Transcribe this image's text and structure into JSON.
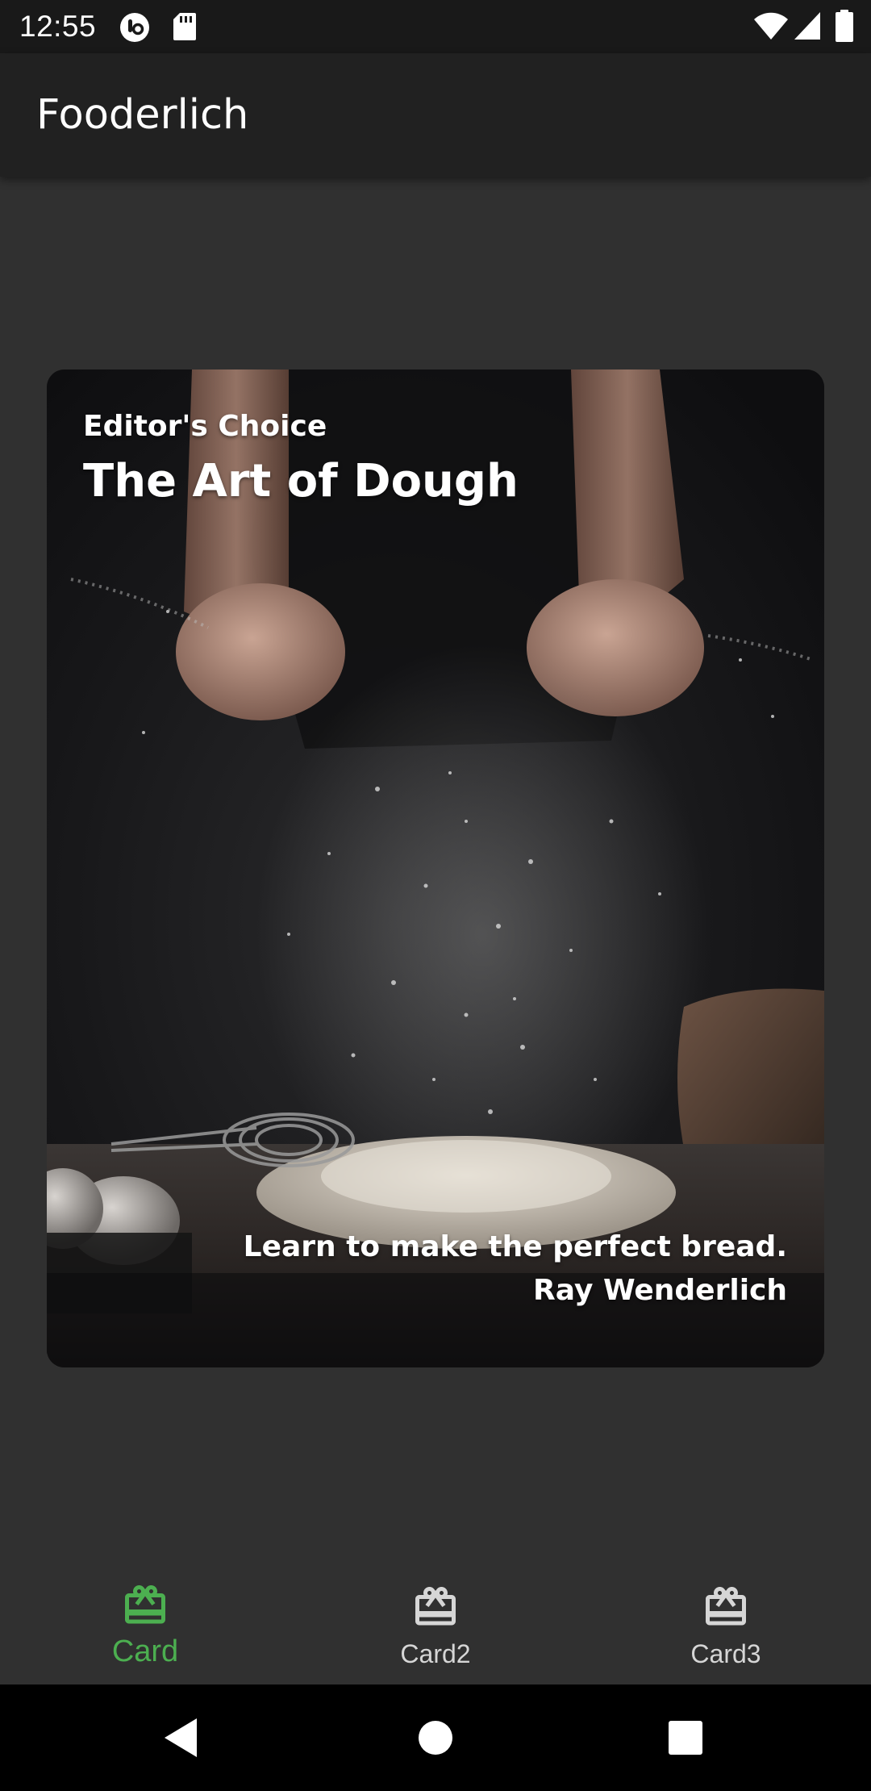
{
  "status_bar": {
    "time": "12:55",
    "left_icons": [
      "notification-badge-icon",
      "sd-card-icon"
    ],
    "right_icons": [
      "wifi-icon",
      "signal-icon",
      "battery-icon"
    ]
  },
  "app_bar": {
    "title": "Fooderlich"
  },
  "card": {
    "subtitle": "Editor's Choice",
    "title": "The Art of Dough",
    "description": "Learn to make the perfect bread.",
    "author": "Ray Wenderlich"
  },
  "bottom_nav": {
    "active_color": "#4caf50",
    "inactive_color": "#d6d6d6",
    "items": [
      {
        "label": "Card",
        "icon": "card-giftcard-icon",
        "active": true
      },
      {
        "label": "Card2",
        "icon": "card-giftcard-icon",
        "active": false
      },
      {
        "label": "Card3",
        "icon": "card-giftcard-icon",
        "active": false
      }
    ]
  },
  "system_nav": {
    "buttons": [
      "back-icon",
      "home-icon",
      "recents-icon"
    ]
  }
}
